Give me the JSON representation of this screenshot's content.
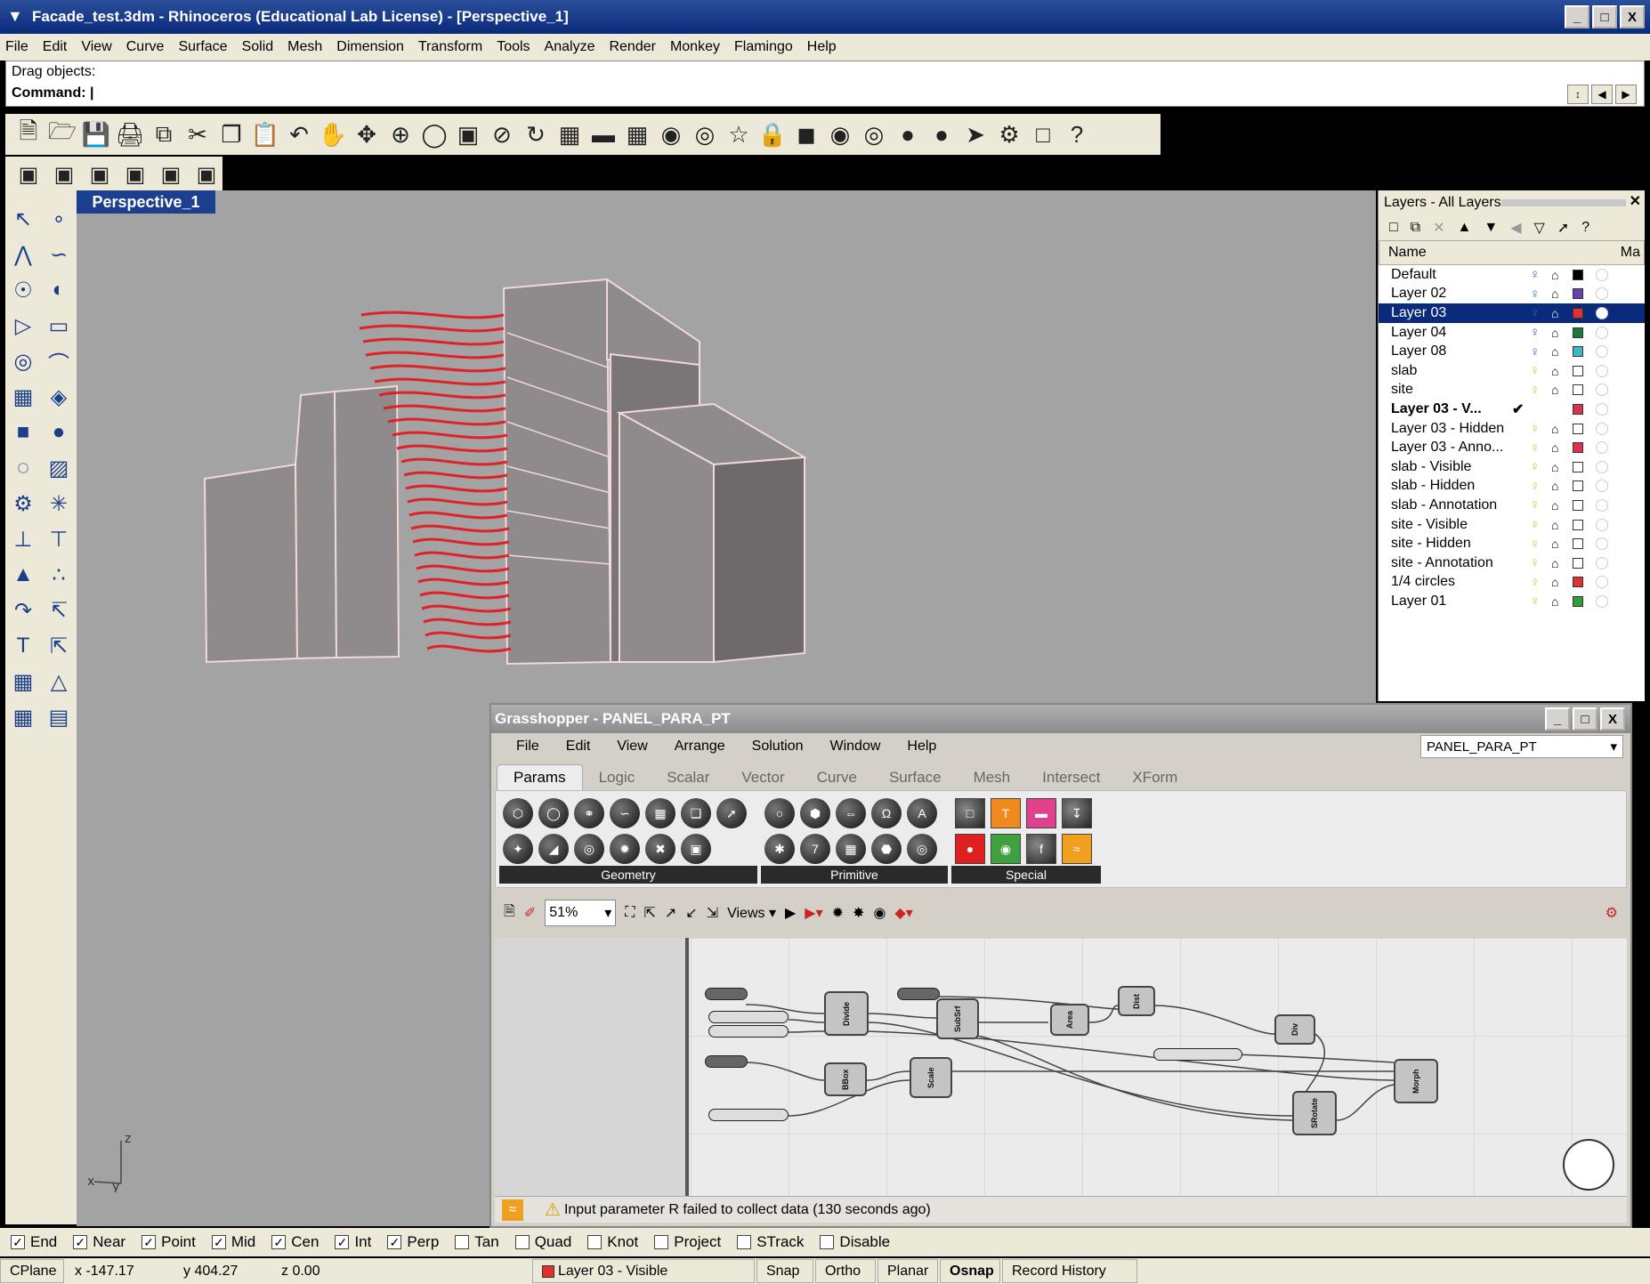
{
  "window": {
    "title": "Facade_test.3dm - Rhinoceros (Educational Lab License) - [Perspective_1]",
    "min": "_",
    "max": "□",
    "close": "X"
  },
  "menu": [
    "File",
    "Edit",
    "View",
    "Curve",
    "Surface",
    "Solid",
    "Mesh",
    "Dimension",
    "Transform",
    "Tools",
    "Analyze",
    "Render",
    "Monkey",
    "Flamingo",
    "Help"
  ],
  "command": {
    "prompt": "Drag objects:",
    "label": "Command:"
  },
  "viewport": {
    "name": "Perspective_1",
    "axis_z": "z",
    "axis_x": "x",
    "axis_y": "y"
  },
  "layers": {
    "title": "Layers - All Layers",
    "col_name": "Name",
    "col_ma": "Ma",
    "items": [
      {
        "name": "Default",
        "color": "#000000",
        "on": true
      },
      {
        "name": "Layer 02",
        "color": "#6a3fb0",
        "on": true
      },
      {
        "name": "Layer 03",
        "color": "#e03030",
        "on": true,
        "selected": true
      },
      {
        "name": "Layer 04",
        "color": "#1b7a3a",
        "on": true
      },
      {
        "name": "Layer 08",
        "color": "#3fb7c0",
        "on": true
      },
      {
        "name": "slab",
        "color": "#ffffff",
        "on": true
      },
      {
        "name": "site",
        "color": "#ffffff",
        "on": true
      },
      {
        "name": "Layer 03 - V...",
        "color": "#e03050",
        "current": true,
        "check": "✔"
      },
      {
        "name": "Layer 03 - Hidden",
        "color": "#ffffff",
        "on": true
      },
      {
        "name": "Layer 03 - Anno...",
        "color": "#e03050",
        "on": true
      },
      {
        "name": "slab - Visible",
        "color": "#ffffff",
        "on": true
      },
      {
        "name": "slab - Hidden",
        "color": "#ffffff",
        "on": true
      },
      {
        "name": "slab - Annotation",
        "color": "#ffffff",
        "on": true
      },
      {
        "name": "site - Visible",
        "color": "#ffffff",
        "on": true
      },
      {
        "name": "site - Hidden",
        "color": "#ffffff",
        "on": true
      },
      {
        "name": "site - Annotation",
        "color": "#ffffff",
        "on": true
      },
      {
        "name": "1/4 circles",
        "color": "#e03030",
        "on": true
      },
      {
        "name": "Layer 01",
        "color": "#2fa030",
        "on": true
      }
    ]
  },
  "grasshopper": {
    "title": "Grasshopper - PANEL_PARA_PT",
    "doc": "PANEL_PARA_PT",
    "menu": [
      "File",
      "Edit",
      "View",
      "Arrange",
      "Solution",
      "Window",
      "Help"
    ],
    "tabs": [
      "Params",
      "Logic",
      "Scalar",
      "Vector",
      "Curve",
      "Surface",
      "Mesh",
      "Intersect",
      "XForm"
    ],
    "groups": [
      "Geometry",
      "Primitive",
      "Special"
    ],
    "zoom": "51%",
    "views": "Views",
    "components": [
      "Divide",
      "SubSrf",
      "Area",
      "Dist",
      "Div",
      "BBox",
      "Scale",
      "SRotate",
      "Morph"
    ],
    "status": "Input parameter R failed to collect data (130 seconds ago)"
  },
  "osnap": [
    {
      "label": "End",
      "on": true
    },
    {
      "label": "Near",
      "on": true
    },
    {
      "label": "Point",
      "on": true
    },
    {
      "label": "Mid",
      "on": true
    },
    {
      "label": "Cen",
      "on": true
    },
    {
      "label": "Int",
      "on": true
    },
    {
      "label": "Perp",
      "on": true
    },
    {
      "label": "Tan",
      "on": false
    },
    {
      "label": "Quad",
      "on": false
    },
    {
      "label": "Knot",
      "on": false
    },
    {
      "label": "Project",
      "on": false
    },
    {
      "label": "STrack",
      "on": false
    },
    {
      "label": "Disable",
      "on": false
    }
  ],
  "status": {
    "cplane": "CPlane",
    "x": "x -147.17",
    "y": "y 404.27",
    "z": "z 0.00",
    "layer": "Layer 03 - Visible",
    "layer_color": "#e03030",
    "snap": "Snap",
    "ortho": "Ortho",
    "planar": "Planar",
    "osnap": "Osnap",
    "history": "Record History"
  }
}
